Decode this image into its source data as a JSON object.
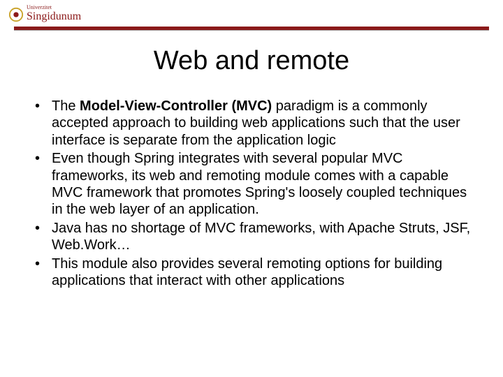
{
  "logo": {
    "name": "Singidunum",
    "sub": "Univerzitet"
  },
  "title": "Web and remote",
  "bullets": [
    {
      "pre": "The ",
      "bold": "Model-View-Controller (MVC) ",
      "post": "paradigm is a commonly accepted approach to building web applications such that the user interface is separate from the application logic"
    },
    {
      "pre": "",
      "bold": "",
      "post": "Even though Spring integrates with several popular MVC frameworks, its web and remoting module comes with a capable MVC framework that promotes Spring's loosely coupled techniques in the web layer of an application."
    },
    {
      "pre": "",
      "bold": "",
      "post": "Java has no shortage of MVC frameworks, with Apache Struts, JSF, Web.Work…"
    },
    {
      "pre": "",
      "bold": "",
      "post": "This module also provides several remoting options for building applications that interact with other applications"
    }
  ]
}
